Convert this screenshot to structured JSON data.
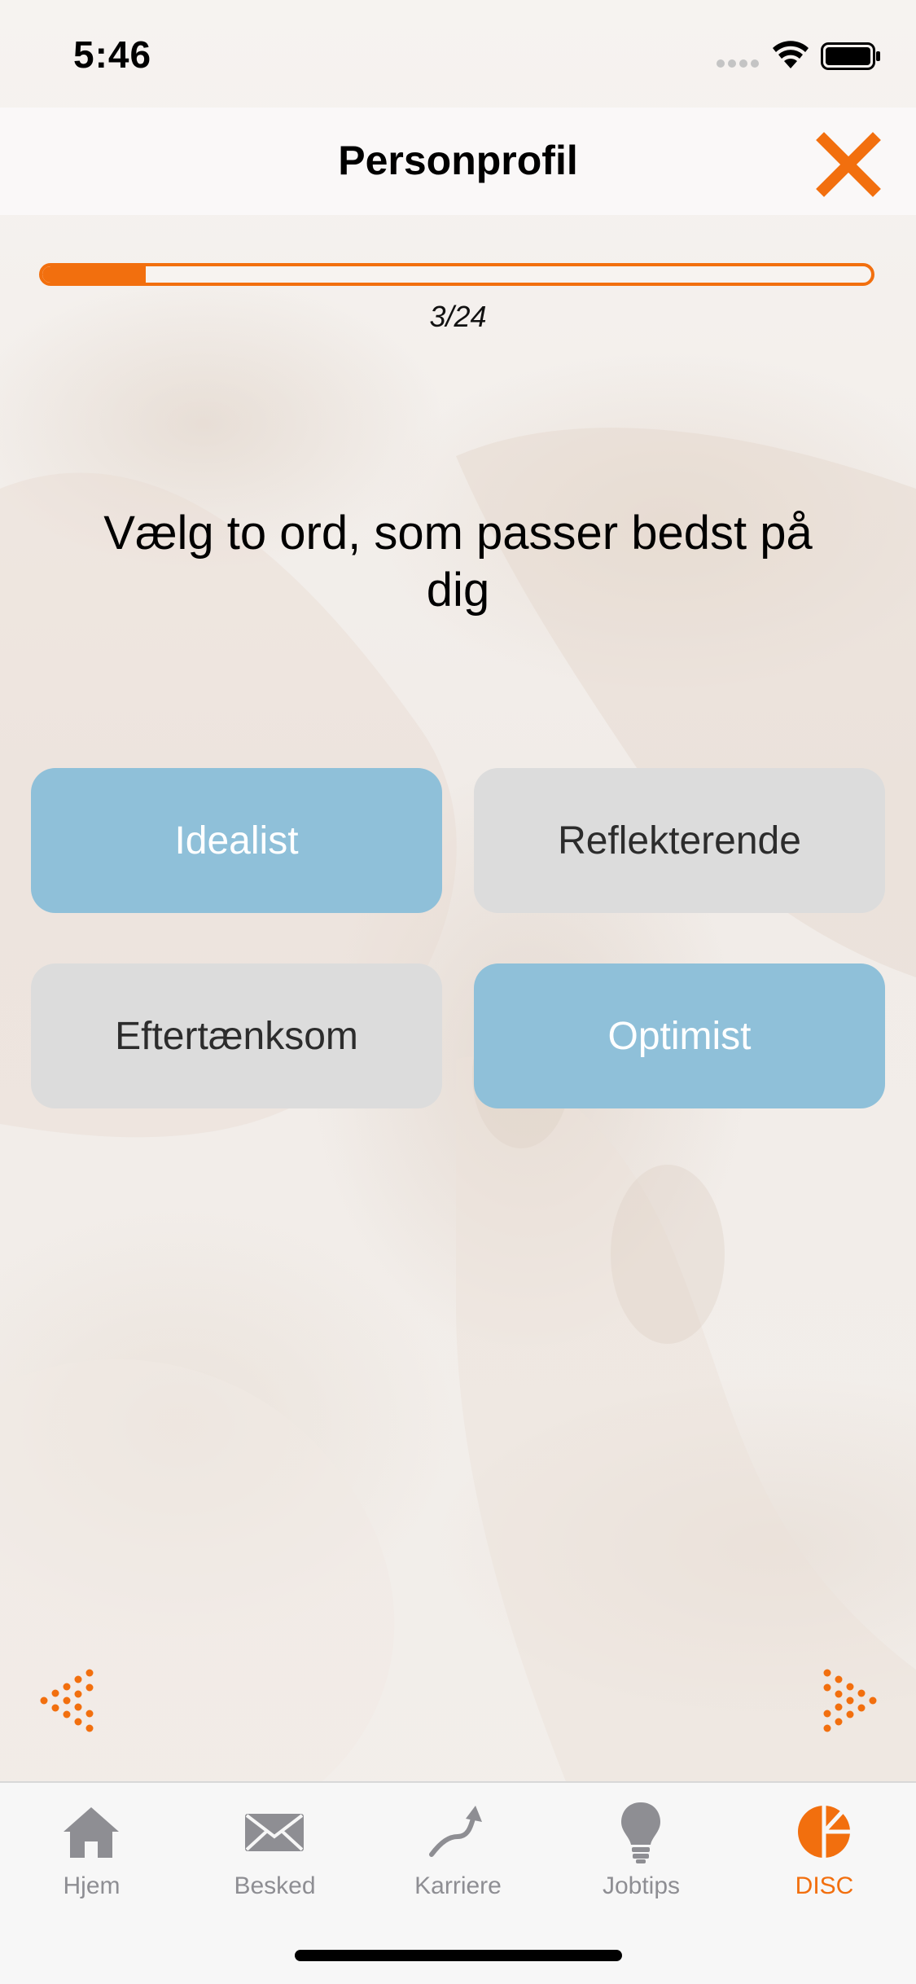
{
  "status_bar": {
    "time": "5:46"
  },
  "nav": {
    "title": "Personprofil",
    "close_icon": "close-x-icon"
  },
  "progress": {
    "label": "3/24",
    "current": 3,
    "total": 24
  },
  "question": {
    "text": "Vælg to ord, som passer bedst på dig"
  },
  "answers": [
    {
      "label": "Idealist",
      "selected": true
    },
    {
      "label": "Reflekterende",
      "selected": false
    },
    {
      "label": "Eftertænksom",
      "selected": false
    },
    {
      "label": "Optimist",
      "selected": true
    }
  ],
  "navigation": {
    "prev_icon": "dotted-arrow-left-icon",
    "next_icon": "dotted-arrow-right-icon"
  },
  "tabs": [
    {
      "label": "Hjem",
      "icon": "house-icon",
      "active": false
    },
    {
      "label": "Besked",
      "icon": "envelope-icon",
      "active": false
    },
    {
      "label": "Karriere",
      "icon": "rising-arrow-icon",
      "active": false
    },
    {
      "label": "Jobtips",
      "icon": "lightbulb-icon",
      "active": false
    },
    {
      "label": "DISC",
      "icon": "disc-pie-icon",
      "active": true
    }
  ],
  "colors": {
    "accent": "#f26f0e",
    "selected": "#8fc0d9",
    "unselected": "#dcdcdc",
    "tab_inactive": "#8e8e93"
  }
}
